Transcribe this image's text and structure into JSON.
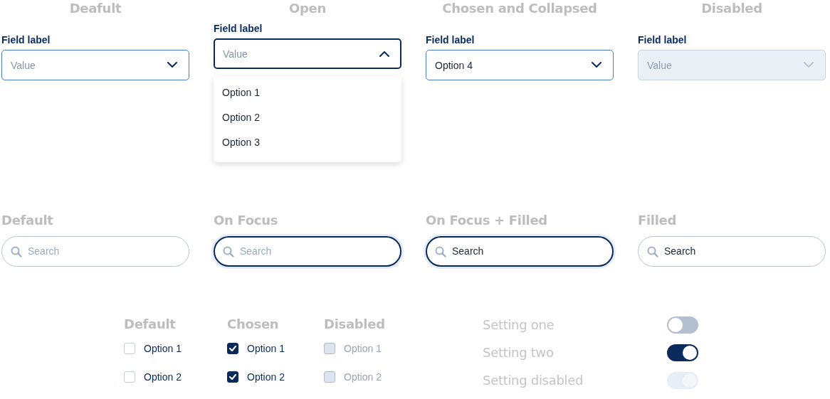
{
  "dropdowns": [
    {
      "heading": "Deafult",
      "label": "Field label",
      "value": "Value",
      "filled": false,
      "open": false,
      "disabled": false
    },
    {
      "heading": "Open",
      "label": "Field label",
      "value": "Value",
      "filled": false,
      "open": true,
      "disabled": false,
      "options": [
        "Option 1",
        "Option 2",
        "Option 3"
      ]
    },
    {
      "heading": "Chosen and Collapsed",
      "label": "Field label",
      "value": "Option 4",
      "filled": true,
      "open": false,
      "disabled": false
    },
    {
      "heading": "Disabled",
      "label": "Field label",
      "value": "Value",
      "filled": false,
      "open": false,
      "disabled": true
    }
  ],
  "searches": [
    {
      "heading": "Default",
      "placeholder": "Search",
      "focused": false
    },
    {
      "heading": "On Focus",
      "placeholder": "Search",
      "focused": true
    },
    {
      "heading": "On Focus + Filled",
      "value": "Search",
      "focused": true
    },
    {
      "heading": "Filled",
      "value": "Search",
      "focused": false
    }
  ],
  "checkbox_groups": [
    {
      "heading": "Default",
      "disabled": false,
      "items": [
        {
          "label": "Option 1",
          "checked": false
        },
        {
          "label": "Option 2",
          "checked": false
        }
      ]
    },
    {
      "heading": "Chosen",
      "disabled": false,
      "items": [
        {
          "label": "Option 1",
          "checked": true
        },
        {
          "label": "Option 2",
          "checked": true
        }
      ]
    },
    {
      "heading": "Disabled",
      "disabled": true,
      "items": [
        {
          "label": "Option 1",
          "checked": false
        },
        {
          "label": "Option 2",
          "checked": false
        }
      ]
    }
  ],
  "settings": [
    {
      "label": "Setting one",
      "on": false,
      "disabled": false
    },
    {
      "label": "Setting two",
      "on": true,
      "disabled": false
    },
    {
      "label": "Setting disabled",
      "on": true,
      "disabled": true
    }
  ]
}
